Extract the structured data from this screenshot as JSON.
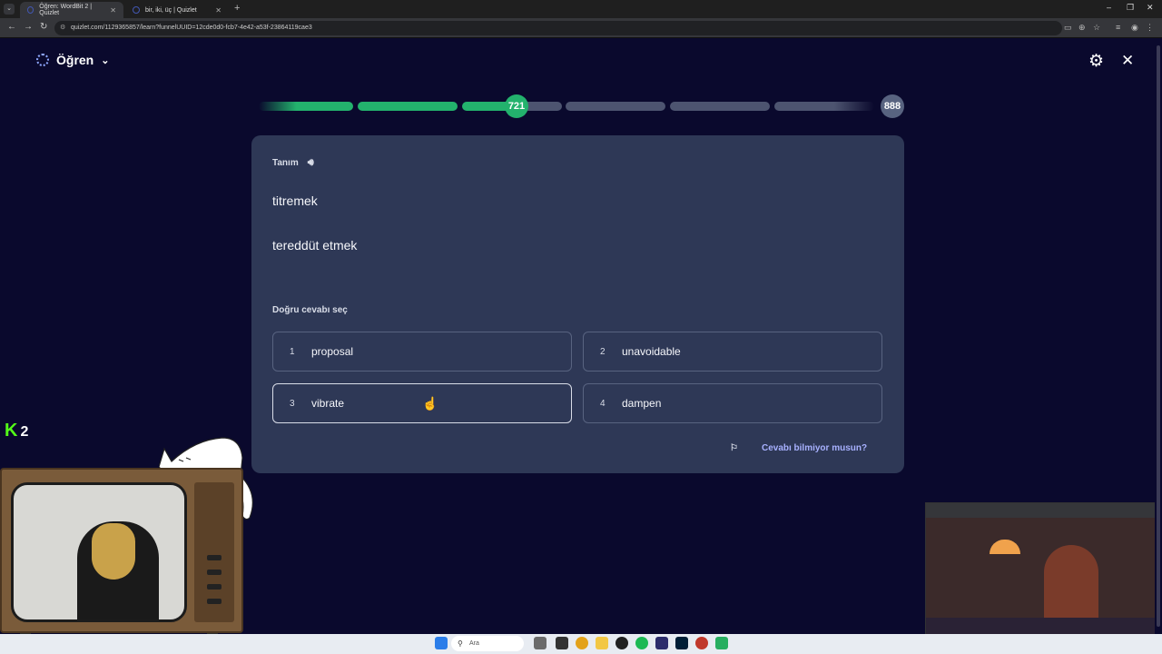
{
  "browser": {
    "tabs": [
      {
        "title": "Öğren: WordBit 2 | Quizlet",
        "active": true
      },
      {
        "title": "bir, iki, üç | Quizlet",
        "active": false
      }
    ],
    "url": "quizlet.com/1129365857/learn?funnelUUID=12cde0d0-fcb7-4e42-a53f-23864119cae3"
  },
  "header": {
    "mode_label": "Öğren"
  },
  "progress": {
    "current": "721",
    "total": "888",
    "completed_fraction": 0.33
  },
  "question": {
    "section_label": "Tanım",
    "definitions": [
      "titremek",
      "tereddüt etmek"
    ],
    "prompt": "Doğru cevabı seç",
    "options": [
      {
        "num": "1",
        "text": "proposal"
      },
      {
        "num": "2",
        "text": "unavoidable"
      },
      {
        "num": "3",
        "text": "vibrate"
      },
      {
        "num": "4",
        "text": "dampen"
      }
    ],
    "dont_know": "Cevabı bilmiyor musun?"
  },
  "overlay": {
    "kick_count": "2"
  },
  "taskbar": {
    "search_placeholder": "Ara"
  },
  "colors": {
    "background": "#0a092d",
    "card": "#2e3856",
    "progress_done": "#23b26d",
    "progress_todo": "#4d5470",
    "link": "#a8b1ff",
    "kick": "#53fc18"
  }
}
